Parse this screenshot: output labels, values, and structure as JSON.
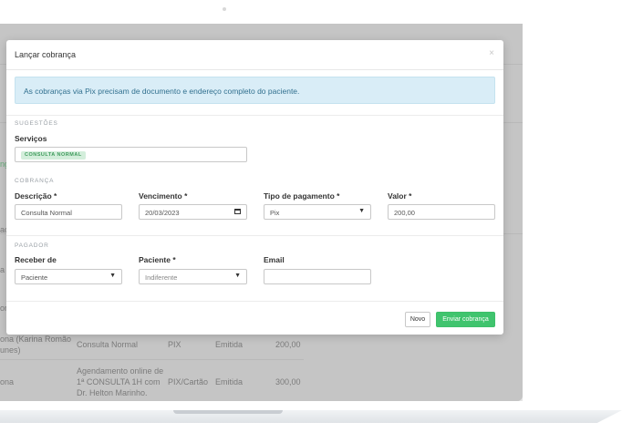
{
  "background_table": {
    "rows": [
      {
        "patient": "ona (Karina Romão",
        "patient_line2": "unes)",
        "description": "Consulta Normal",
        "method": "PIX",
        "status": "Emitida",
        "value": "200,00"
      },
      {
        "patient": "ona",
        "description_line1": "Agendamento online de",
        "description_line2": "1ª CONSULTA 1H com",
        "description_line3": "Dr. Helton Marinho.",
        "method": "PIX/Cartão",
        "status": "Emitida",
        "value": "300,00"
      }
    ],
    "left_fragments": [
      "ng",
      "ac",
      "a",
      "on"
    ]
  },
  "modal": {
    "title": "Lançar cobrança",
    "close": "×",
    "alert": "As cobranças via Pix precisam de documento e endereço completo do paciente.",
    "sugestoes": {
      "section": "SUGESTÕES",
      "servicos_label": "Serviços",
      "tag": "CONSULTA NORMAL"
    },
    "cobranca": {
      "section": "COBRANÇA",
      "descricao_label": "Descrição *",
      "descricao_value": "Consulta Normal",
      "vencimento_label": "Vencimento *",
      "vencimento_value": "20/03/2023",
      "tipo_label": "Tipo de pagamento *",
      "tipo_value": "Pix",
      "valor_label": "Valor *",
      "valor_value": "200,00"
    },
    "pagador": {
      "section": "PAGADOR",
      "receber_label": "Receber de",
      "receber_value": "Paciente",
      "paciente_label": "Paciente *",
      "paciente_value": "Indiferente",
      "email_label": "Email",
      "email_value": ""
    },
    "buttons": {
      "novo": "Novo",
      "enviar": "Enviar cobrança"
    }
  },
  "colors": {
    "alert_bg": "#d9edf7",
    "alert_text": "#31708f",
    "send_button": "#40c46e",
    "tag_bg": "#d3eedb"
  },
  "icons": {
    "caret": "▼",
    "calendar": "calendar-icon"
  }
}
